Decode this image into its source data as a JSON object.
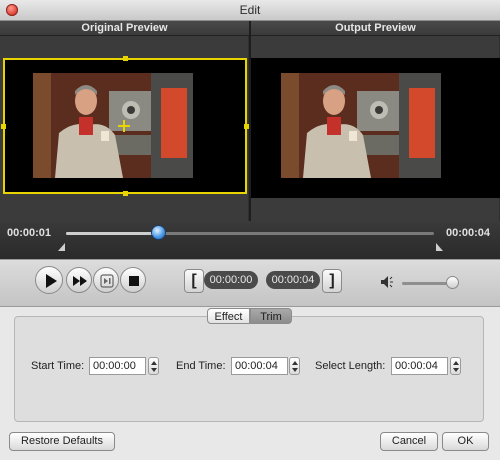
{
  "window": {
    "title": "Edit"
  },
  "preview": {
    "original_label": "Original Preview",
    "output_label": "Output Preview"
  },
  "timeline": {
    "current_time": "00:00:01",
    "end_time": "00:00:04",
    "playhead_fraction": 0.25
  },
  "controls": {
    "play_icon": "play-icon",
    "fast_forward_icon": "fast-forward-icon",
    "step_icon": "step-frame-icon",
    "stop_icon": "stop-icon",
    "start_bracket": "[",
    "start_time": "00:00:00",
    "end_time": "00:00:04",
    "end_bracket": "]",
    "volume_icon": "speaker-icon",
    "volume_fraction": 0.9
  },
  "tabs": [
    {
      "label": "Effect",
      "selected": false
    },
    {
      "label": "Trim",
      "selected": true
    }
  ],
  "trim": {
    "start_label": "Start Time:",
    "start_value": "00:00:00",
    "end_label": "End Time:",
    "end_value": "00:00:04",
    "length_label": "Select Length:",
    "length_value": "00:00:04"
  },
  "footer": {
    "restore_label": "Restore Defaults",
    "cancel_label": "Cancel",
    "ok_label": "OK"
  },
  "colors": {
    "crop_box": "#e8d400",
    "playhead": "#4b9be8",
    "timeline_bg": "#2a2a2a"
  }
}
